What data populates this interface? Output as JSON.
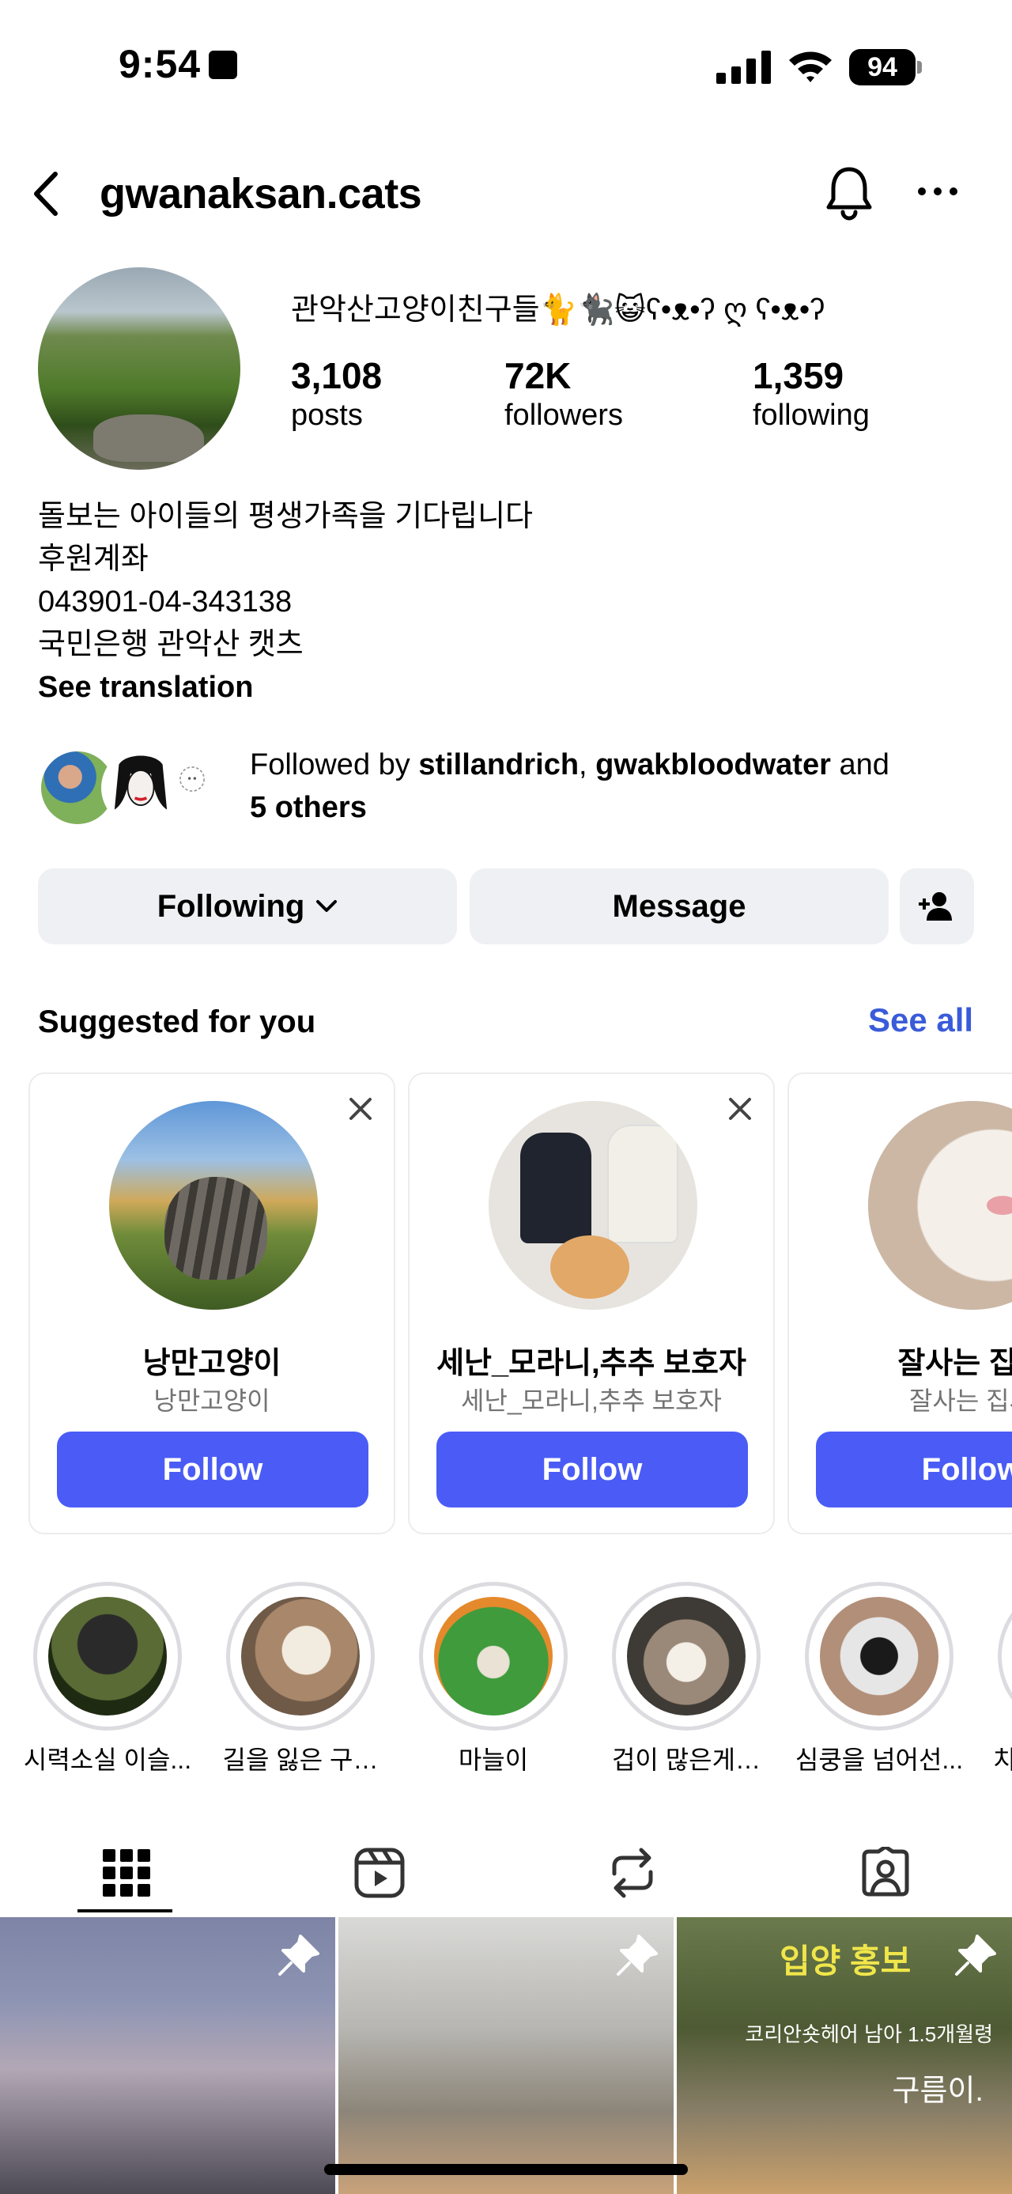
{
  "status_bar": {
    "time": "9:54",
    "battery": "94"
  },
  "header": {
    "username": "gwanaksan.cats"
  },
  "profile": {
    "display_name": "관악산고양이친구들🐈🐈‍⬛😺ʕ•ᴥ•ʔ ღ ʕ•ᴥ•ʔ",
    "stats": [
      {
        "value": "3,108",
        "label": "posts"
      },
      {
        "value": "72K",
        "label": "followers"
      },
      {
        "value": "1,359",
        "label": "following"
      }
    ],
    "bio": [
      "돌보는 아이들의 평생가족을 기다립니다",
      "후원계좌",
      "043901-04-343138",
      "국민은행 관악산 캣츠"
    ],
    "see_translation": "See translation",
    "followed_by": {
      "prefix": "Followed by ",
      "user1": "stillandrich",
      "sep": ", ",
      "user2": "gwakbloodwater",
      "and": " and",
      "others": "5 others"
    }
  },
  "actions": {
    "following": "Following",
    "message": "Message"
  },
  "suggested": {
    "title": "Suggested for you",
    "see_all": "See all",
    "cards": [
      {
        "name": "낭만고양이",
        "sub": "낭만고양이",
        "follow": "Follow"
      },
      {
        "name": "세난_모라니,추추 보호자",
        "sub": "세난_모라니,추추 보호자",
        "follow": "Follow"
      },
      {
        "name": "잘사는 집사",
        "sub": "잘사는 집사",
        "follow": "Follow"
      }
    ]
  },
  "highlights": [
    {
      "label": "시력소실 이슬..."
    },
    {
      "label": "길을 잃은 구…"
    },
    {
      "label": "마늘이"
    },
    {
      "label": "겁이 많은게…"
    },
    {
      "label": "심쿵을 넘어선..."
    },
    {
      "label": "치"
    }
  ],
  "grid": {
    "post3_title": "입양 홍보",
    "post3_note": "코리안숏헤어 남아 1.5개월령",
    "post3_name": "구름이."
  }
}
